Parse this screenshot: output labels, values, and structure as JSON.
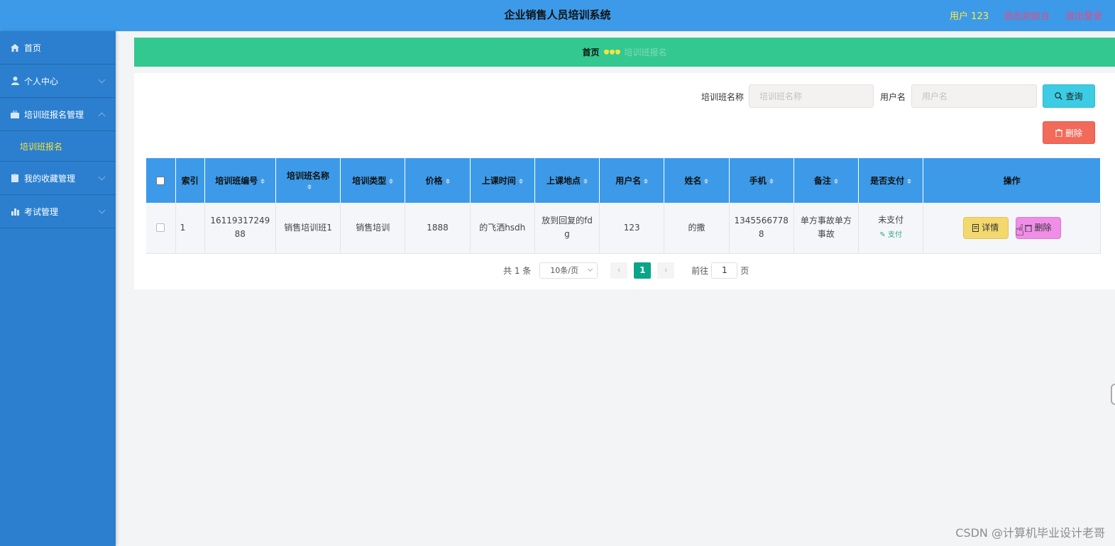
{
  "header": {
    "title": "企业销售人员培训系统",
    "user_label": "用户 123",
    "to_front": "退出到前台",
    "logout": "退出登录"
  },
  "sidebar": {
    "items": [
      {
        "label": "首页",
        "icon": "home-icon"
      },
      {
        "label": "个人中心",
        "icon": "user-icon"
      },
      {
        "label": "培训班报名管理",
        "icon": "briefcase-icon",
        "expanded": true
      },
      {
        "label": "培训班报名",
        "submenu": true
      },
      {
        "label": "我的收藏管理",
        "icon": "clipboard-icon"
      },
      {
        "label": "考试管理",
        "icon": "bar-chart-icon"
      }
    ]
  },
  "breadcrumb": {
    "home": "首页",
    "current": "培训班报名"
  },
  "search": {
    "class_name_label": "培训班名称",
    "class_name_placeholder": "培训班名称",
    "username_label": "用户名",
    "username_placeholder": "用户名",
    "query_button": "查询",
    "delete_button": "删除"
  },
  "table": {
    "headers": [
      "索引",
      "培训班编号",
      "培训班名称",
      "培训类型",
      "价格",
      "上课时间",
      "上课地点",
      "用户名",
      "姓名",
      "手机",
      "备注",
      "是否支付",
      "操作"
    ],
    "rows": [
      {
        "index": "1",
        "class_no": "1611931724988",
        "class_name": "销售培训班1",
        "class_type": "销售培训",
        "price": "1888",
        "class_time": "的飞洒hsdh",
        "location": "放到回复的fdg",
        "username": "123",
        "name": "的撒",
        "phone": "13455667788",
        "remark": "单方事故单方事故",
        "pay_status": "未支付",
        "pay_action": "支付",
        "detail_button": "详情",
        "delete_button": "删除"
      }
    ]
  },
  "pagination": {
    "total": "共 1 条",
    "page_size": "10条/页",
    "current_page": "1",
    "goto_label": "前往",
    "goto_value": "1",
    "page_suffix": "页"
  },
  "watermark": "CSDN @计算机毕业设计老哥",
  "colors": {
    "header_bg": "#3d9ae8",
    "sidebar_bg": "#2b7fce",
    "breadcrumb_bg": "#33c88f",
    "active_page": "#0aa588"
  }
}
